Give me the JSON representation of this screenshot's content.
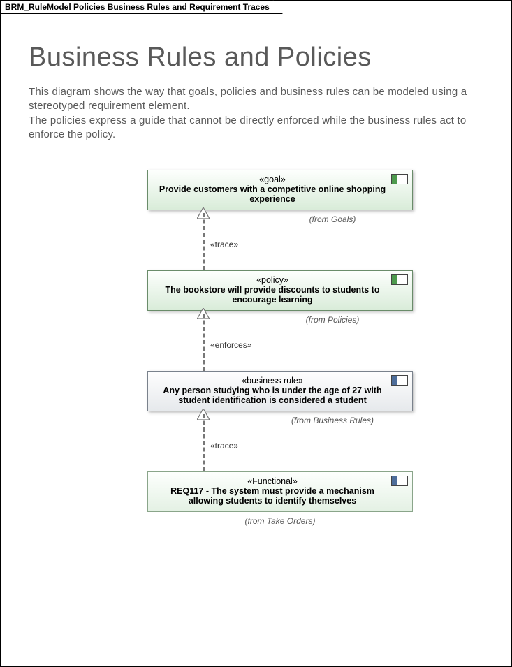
{
  "tab_title": "BRM_RuleModel Policies Business Rules and Requirement Traces",
  "heading": "Business Rules and Policies",
  "description_line1": "This diagram shows the way that goals, policies and business rules can be modeled using a stereotyped requirement element.",
  "description_line2": "The policies express a guide that cannot be directly enforced while the business rules act to enforce the policy.",
  "nodes": {
    "goal": {
      "stereotype": "«goal»",
      "text": "Provide customers with a competitive online shopping experience",
      "from": "(from Goals)"
    },
    "policy": {
      "stereotype": "«policy»",
      "text": "The bookstore will provide discounts to students to encourage learning",
      "from": "(from Policies)"
    },
    "rule": {
      "stereotype": "«business rule»",
      "text": "Any person studying who is under the age of 27 with student identification is considered a student",
      "from": "(from Business Rules)"
    },
    "functional": {
      "stereotype": "«Functional»",
      "text": "REQ117 - The system must provide a mechanism allowing students to identify themselves",
      "from": "(from Take Orders)"
    }
  },
  "connectors": {
    "c1": "«trace»",
    "c2": "«enforces»",
    "c3": "«trace»"
  }
}
